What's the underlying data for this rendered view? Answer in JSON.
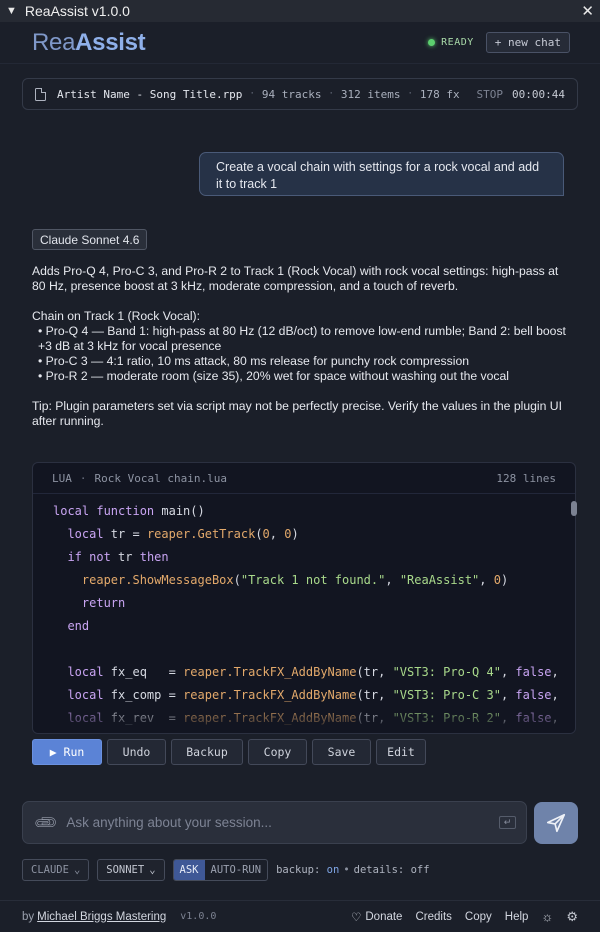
{
  "window": {
    "title": "ReaAssist v1.0.0"
  },
  "header": {
    "logo_rea": "Rea",
    "logo_assist": "Assist",
    "status": "READY",
    "new_chat": "+ new chat"
  },
  "session": {
    "file": "Artist Name - Song Title.rpp",
    "tracks": "94 tracks",
    "items": "312 items",
    "fx": "178 fx",
    "stop_label": "STOP",
    "time": "00:00:44"
  },
  "user_message": "Create a vocal chain with settings for a rock vocal and add it to track 1",
  "model_badge": "Claude Sonnet 4.6",
  "response": {
    "summary": "Adds Pro-Q 4, Pro-C 3, and Pro-R 2 to Track 1 (Rock Vocal) with rock vocal settings: high-pass at 80 Hz, presence boost at 3 kHz, moderate compression, and a touch of reverb.",
    "chain_title": "Chain on Track 1 (Rock Vocal):",
    "bullets": [
      "• Pro-Q 4 — Band 1: high-pass at 80 Hz (12 dB/oct) to remove low-end rumble; Band 2: bell boost +3 dB at 3 kHz for vocal presence",
      "• Pro-C 3 — 4:1 ratio, 10 ms attack, 80 ms release for punchy rock compression",
      "• Pro-R 2 — moderate room (size 35), 20% wet for space without washing out the vocal"
    ],
    "tip": "Tip: Plugin parameters set via script may not be perfectly precise. Verify the values in the plugin UI after running."
  },
  "code": {
    "lang": "LUA",
    "sep": "·",
    "filename": "Rock Vocal chain.lua",
    "lines_count": "128 lines"
  },
  "actions": {
    "run": "▶ Run",
    "undo": "Undo",
    "backup": "Backup",
    "copy": "Copy",
    "save": "Save",
    "edit": "Edit"
  },
  "input": {
    "placeholder": "Ask anything about your session..."
  },
  "controls": {
    "provider": "CLAUDE",
    "model": "SONNET",
    "mode_ask": "ASK",
    "mode_autorun": "AUTO-RUN",
    "backup_label": "backup:",
    "backup_value": "on",
    "details_label": "details:",
    "details_value": "off"
  },
  "footer": {
    "by": "by",
    "author": "Michael Briggs Mastering",
    "version": "v1.0.0",
    "donate": "Donate",
    "credits": "Credits",
    "copy": "Copy",
    "help": "Help"
  },
  "colors": {
    "accent": "#5b83d6",
    "ready": "#5ccf6f",
    "background": "#1b1f29"
  }
}
